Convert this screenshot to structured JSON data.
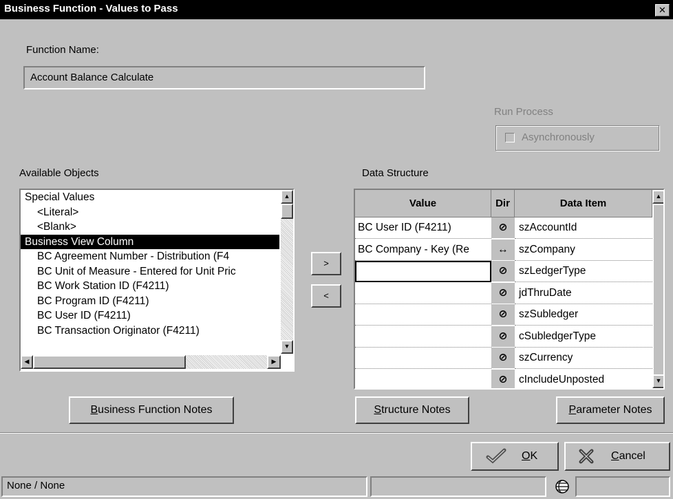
{
  "window": {
    "title": "Business Function - Values to Pass",
    "close_glyph": "✕"
  },
  "function_name": {
    "label": "Function Name:",
    "value": "Account Balance Calculate"
  },
  "run_process": {
    "label": "Run Process",
    "checkbox_label": "Asynchronously",
    "checked": false
  },
  "available_objects": {
    "label": "Available Objects",
    "items": [
      {
        "label": "Special Values",
        "indent": false,
        "selected": false
      },
      {
        "label": "<Literal>",
        "indent": true,
        "selected": false
      },
      {
        "label": "<Blank>",
        "indent": true,
        "selected": false
      },
      {
        "label": "Business View Column",
        "indent": false,
        "selected": true
      },
      {
        "label": "BC Agreement Number - Distribution (F4",
        "indent": true,
        "selected": false
      },
      {
        "label": "BC Unit of Measure - Entered for Unit Pric",
        "indent": true,
        "selected": false
      },
      {
        "label": "BC Work Station ID (F4211)",
        "indent": true,
        "selected": false
      },
      {
        "label": "BC Program ID (F4211)",
        "indent": true,
        "selected": false
      },
      {
        "label": "BC User ID (F4211)",
        "indent": true,
        "selected": false
      },
      {
        "label": "BC Transaction Originator (F4211)",
        "indent": true,
        "selected": false
      }
    ]
  },
  "transfer": {
    "add_label": ">",
    "remove_label": "<"
  },
  "data_structure": {
    "label": "Data Structure",
    "columns": {
      "value": "Value",
      "dir": "Dir",
      "data_item": "Data Item"
    },
    "rows": [
      {
        "value": "BC User ID (F4211)",
        "dir": "⊘",
        "dir_icon": "input-only-icon",
        "data_item": "szAccountId"
      },
      {
        "value": "BC Company - Key (Re",
        "dir": "↔",
        "dir_icon": "bidirectional-icon",
        "data_item": "szCompany"
      },
      {
        "value": "",
        "dir": "⊘",
        "dir_icon": "input-only-icon",
        "data_item": "szLedgerType"
      },
      {
        "value": "",
        "dir": "⊘",
        "dir_icon": "input-only-icon",
        "data_item": "jdThruDate"
      },
      {
        "value": "",
        "dir": "⊘",
        "dir_icon": "input-only-icon",
        "data_item": "szSubledger"
      },
      {
        "value": "",
        "dir": "⊘",
        "dir_icon": "input-only-icon",
        "data_item": "cSubledgerType"
      },
      {
        "value": "",
        "dir": "⊘",
        "dir_icon": "input-only-icon",
        "data_item": "szCurrency"
      },
      {
        "value": "",
        "dir": "⊘",
        "dir_icon": "input-only-icon",
        "data_item": "cIncludeUnposted"
      }
    ]
  },
  "buttons": {
    "bf_notes": {
      "mnemonic": "B",
      "rest": "usiness Function Notes"
    },
    "structure_notes": {
      "mnemonic": "S",
      "rest": "tructure Notes"
    },
    "parameter_notes": {
      "mnemonic": "P",
      "rest": "arameter Notes"
    },
    "ok": {
      "mnemonic": "O",
      "rest": "K"
    },
    "cancel": {
      "mnemonic": "C",
      "rest": "ancel"
    }
  },
  "status_bar": {
    "text": "None / None"
  }
}
